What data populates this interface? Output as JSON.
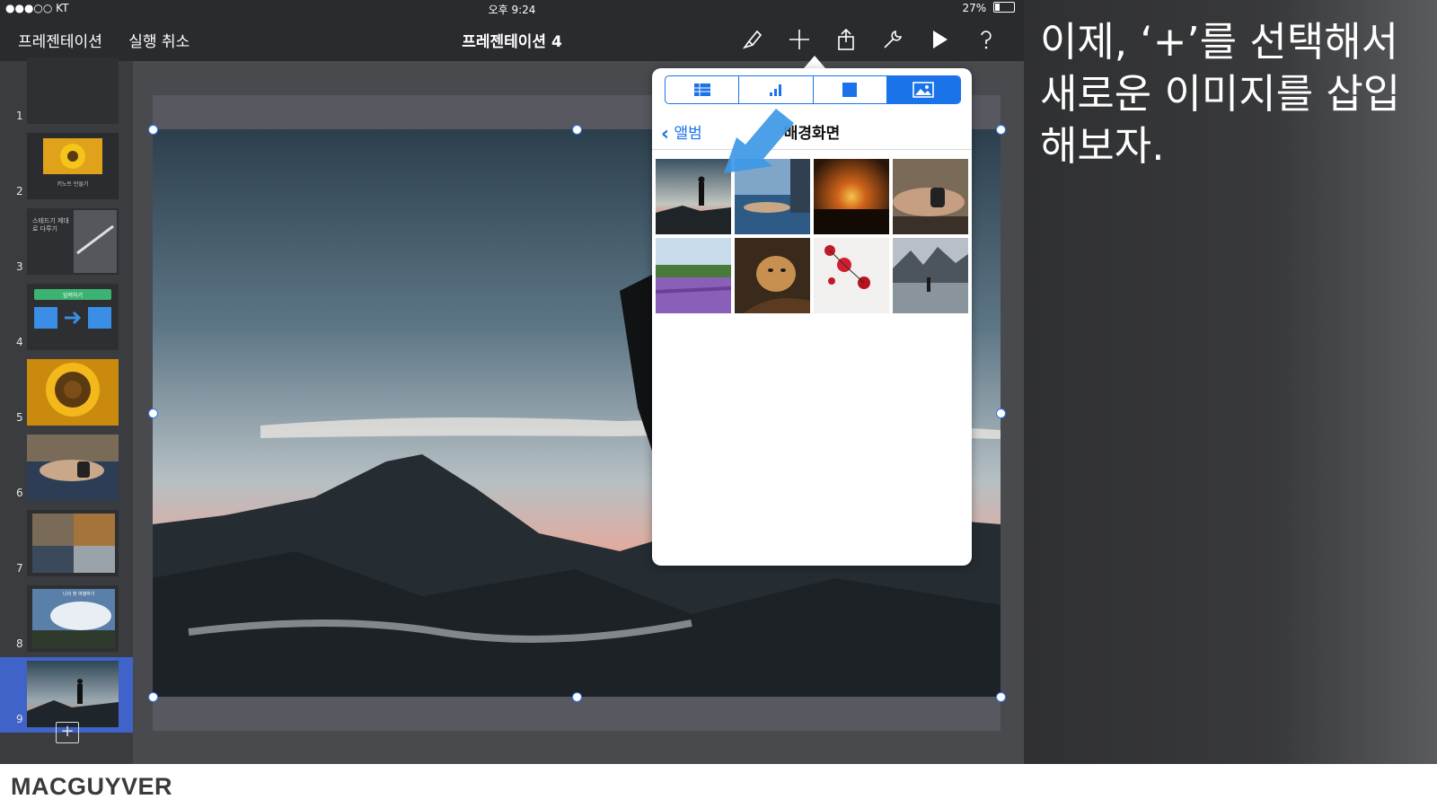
{
  "status_bar": {
    "carrier": "●●●○○ KT",
    "time": "오후 9:24",
    "battery": "27%"
  },
  "toolbar": {
    "presentations_label": "프레젠테이션",
    "undo_label": "실행 취소",
    "document_title": "프레젠테이션 4",
    "icons": [
      "paintbrush-icon",
      "plus-icon",
      "share-icon",
      "wrench-icon",
      "play-icon",
      "help-icon"
    ]
  },
  "sidebar": {
    "slides": [
      {
        "number": "1"
      },
      {
        "number": "2",
        "caption": "키노트 만들기"
      },
      {
        "number": "3",
        "caption": "스테드기 제대로 다루기"
      },
      {
        "number": "4",
        "caption": "입력하기"
      },
      {
        "number": "5"
      },
      {
        "number": "6"
      },
      {
        "number": "7"
      },
      {
        "number": "8",
        "caption": "나의 첫 여행하기"
      },
      {
        "number": "9",
        "selected": true
      }
    ],
    "add_slide_icon": "plus-square-icon"
  },
  "popover": {
    "tabs": [
      "table-icon",
      "chart-icon",
      "shape-icon",
      "image-icon"
    ],
    "selected_tab": "image-icon",
    "back_label": "앨범",
    "album_title": "배경화면",
    "photo_count": 8
  },
  "caption": {
    "text": "이제, ‘+’를 선택해서 새로운 이미지를 삽입해보자."
  },
  "footer": {
    "brand": "MACGUYVER"
  },
  "colors": {
    "accent": "#1a73e8",
    "selected_slide": "#3f63c9",
    "toolbar": "#2a2b2e"
  }
}
